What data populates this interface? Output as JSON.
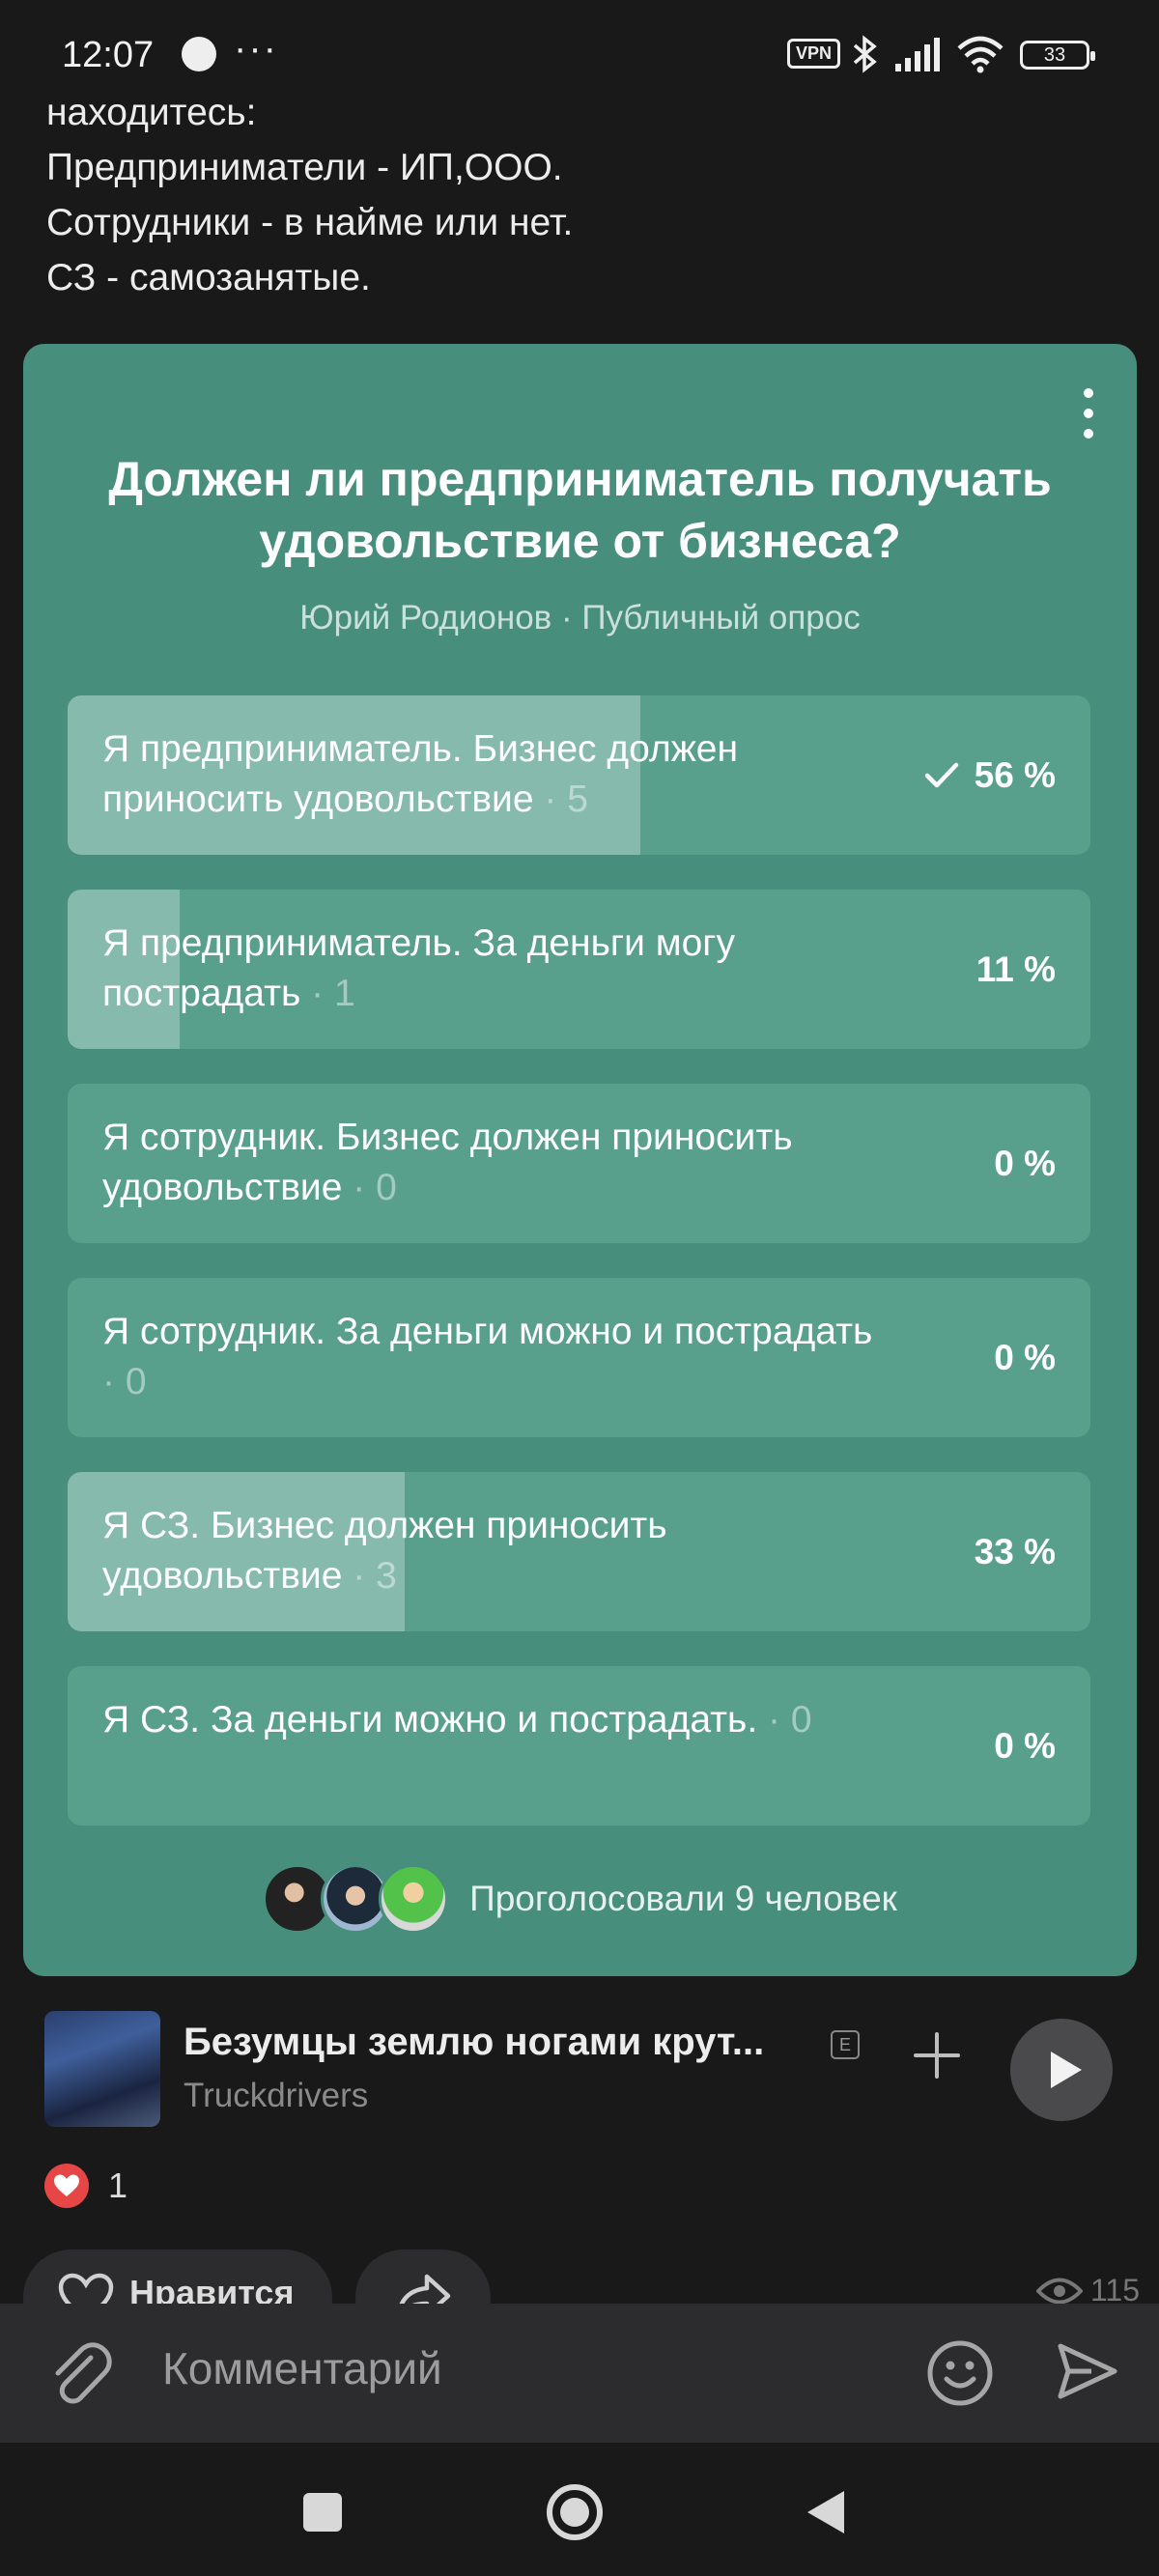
{
  "status_bar": {
    "time": "12:07",
    "vpn": "VPN",
    "battery": "33"
  },
  "post": {
    "lines": [
      "находитесь:",
      "Предприниматели - ИП,ООО.",
      "Сотрудники - в найме или нет.",
      "СЗ - самозанятые."
    ]
  },
  "poll": {
    "title": "Должен ли предприниматель получать удовольствие от бизнеса?",
    "subtitle": "Юрий Родионов · Публичный опрос",
    "options": [
      {
        "text": "Я предприниматель. Бизнес должен приносить удовольствие",
        "count": "· 5",
        "percent": "56 %",
        "share": 0.56,
        "voted": true
      },
      {
        "text": "Я предприниматель. За деньги могу пострадать",
        "count": "· 1",
        "percent": "11 %",
        "share": 0.11,
        "voted": false
      },
      {
        "text": "Я сотрудник. Бизнес должен приносить удовольствие",
        "count": "· 0",
        "percent": "0 %",
        "share": 0,
        "voted": false
      },
      {
        "text": "Я сотрудник. За деньги можно и пострадать",
        "count": "· 0",
        "percent": "0 %",
        "share": 0,
        "voted": false
      },
      {
        "text": "Я СЗ. Бизнес должен приносить удовольствие",
        "count": "· 3",
        "percent": "33 %",
        "share": 0.33,
        "voted": false
      },
      {
        "text": "Я СЗ. За деньги можно и пострадать.",
        "count": "· 0",
        "percent": "0 %",
        "share": 0,
        "voted": false
      }
    ],
    "voters_text": "Проголосовали 9 человек"
  },
  "music": {
    "title": "Безумцы землю ногами крут...",
    "badge": "E",
    "artist": "Truckdrivers"
  },
  "likes": {
    "count": "1",
    "like_label": "Нравится",
    "views": "115"
  },
  "comment": {
    "placeholder": "Комментарий"
  }
}
